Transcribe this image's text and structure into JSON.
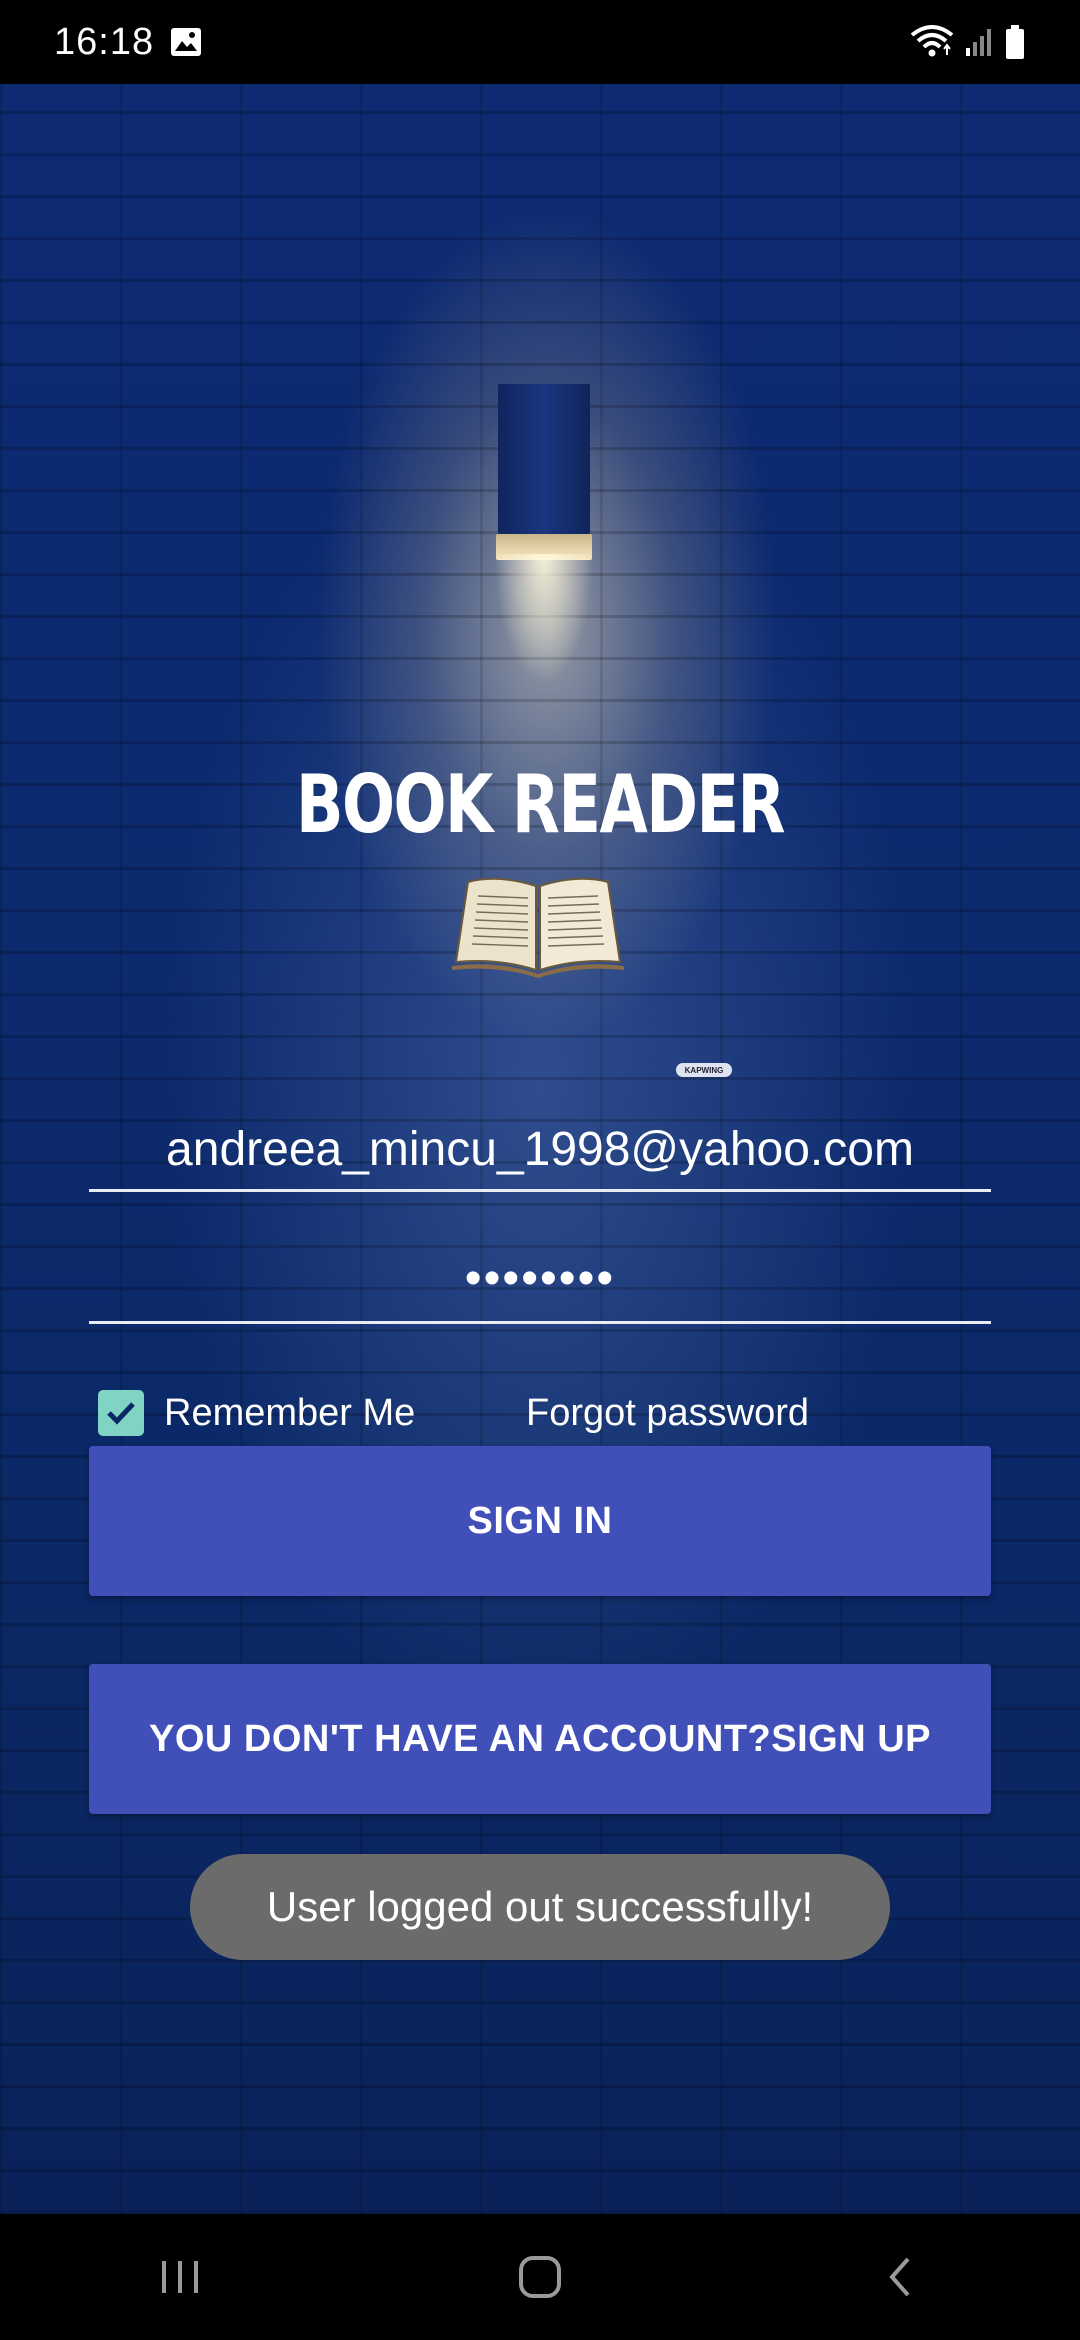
{
  "status_bar": {
    "time": "16:18",
    "icons": [
      "gallery-icon",
      "wifi-icon",
      "signal-icon",
      "battery-icon"
    ]
  },
  "app": {
    "title": "BOOK READER",
    "watermark": "KAPWING"
  },
  "form": {
    "email_value": "andreea_mincu_1998@yahoo.com",
    "password_value": "••••••••",
    "remember_label": "Remember Me",
    "remember_checked": true,
    "forgot_label": "Forgot password",
    "signin_label": "SIGN IN",
    "signup_label": "YOU DON'T HAVE AN ACCOUNT?SIGN UP"
  },
  "toast": {
    "message": "User logged out successfully!"
  },
  "nav_bar": {
    "icons": [
      "recents-icon",
      "home-icon",
      "back-icon"
    ]
  },
  "colors": {
    "button": "#4150b8",
    "checkbox": "#7fd4c4",
    "toast": "#6b6b6b",
    "background": "#0c2a6e"
  }
}
